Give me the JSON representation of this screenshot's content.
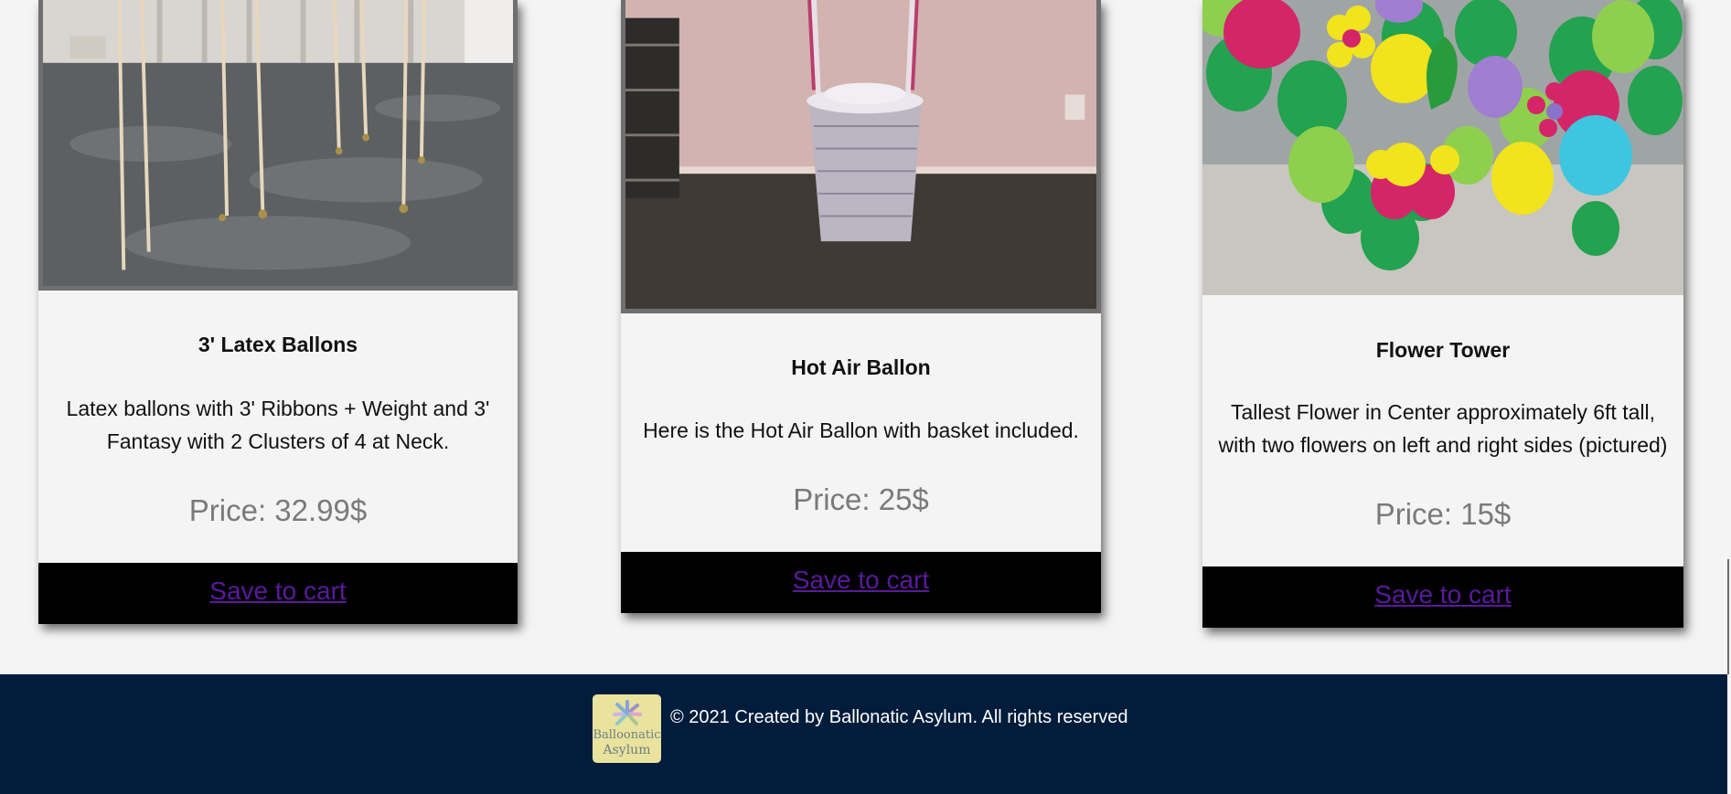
{
  "products": [
    {
      "title": "3' Latex Ballons",
      "description": "Latex ballons with 3' Ribbons + Weight and 3' Fantasy with 2 Clusters of 4 at Neck.",
      "price": "Price: 32.99$",
      "cart_label": "Save to cart"
    },
    {
      "title": "Hot Air Ballon",
      "description": "Here is the Hot Air Ballon with basket included.",
      "price": "Price: 25$",
      "cart_label": "Save to cart"
    },
    {
      "title": "Flower Tower",
      "description": "Tallest Flower in Center approximately 6ft tall, with two flowers on left and right sides (pictured)",
      "price": "Price: 15$",
      "cart_label": "Save to cart"
    }
  ],
  "footer": {
    "copyright": "© 2021 Created by Ballonatic Asylum. All rights reserved",
    "logo_line1": "Balloonatic",
    "logo_line2": "Asylum"
  },
  "colors": {
    "footer_bg": "#021c3b",
    "cart_bar": "#000000",
    "link": "#5a1a9c",
    "price_text": "#7a7a7a"
  }
}
